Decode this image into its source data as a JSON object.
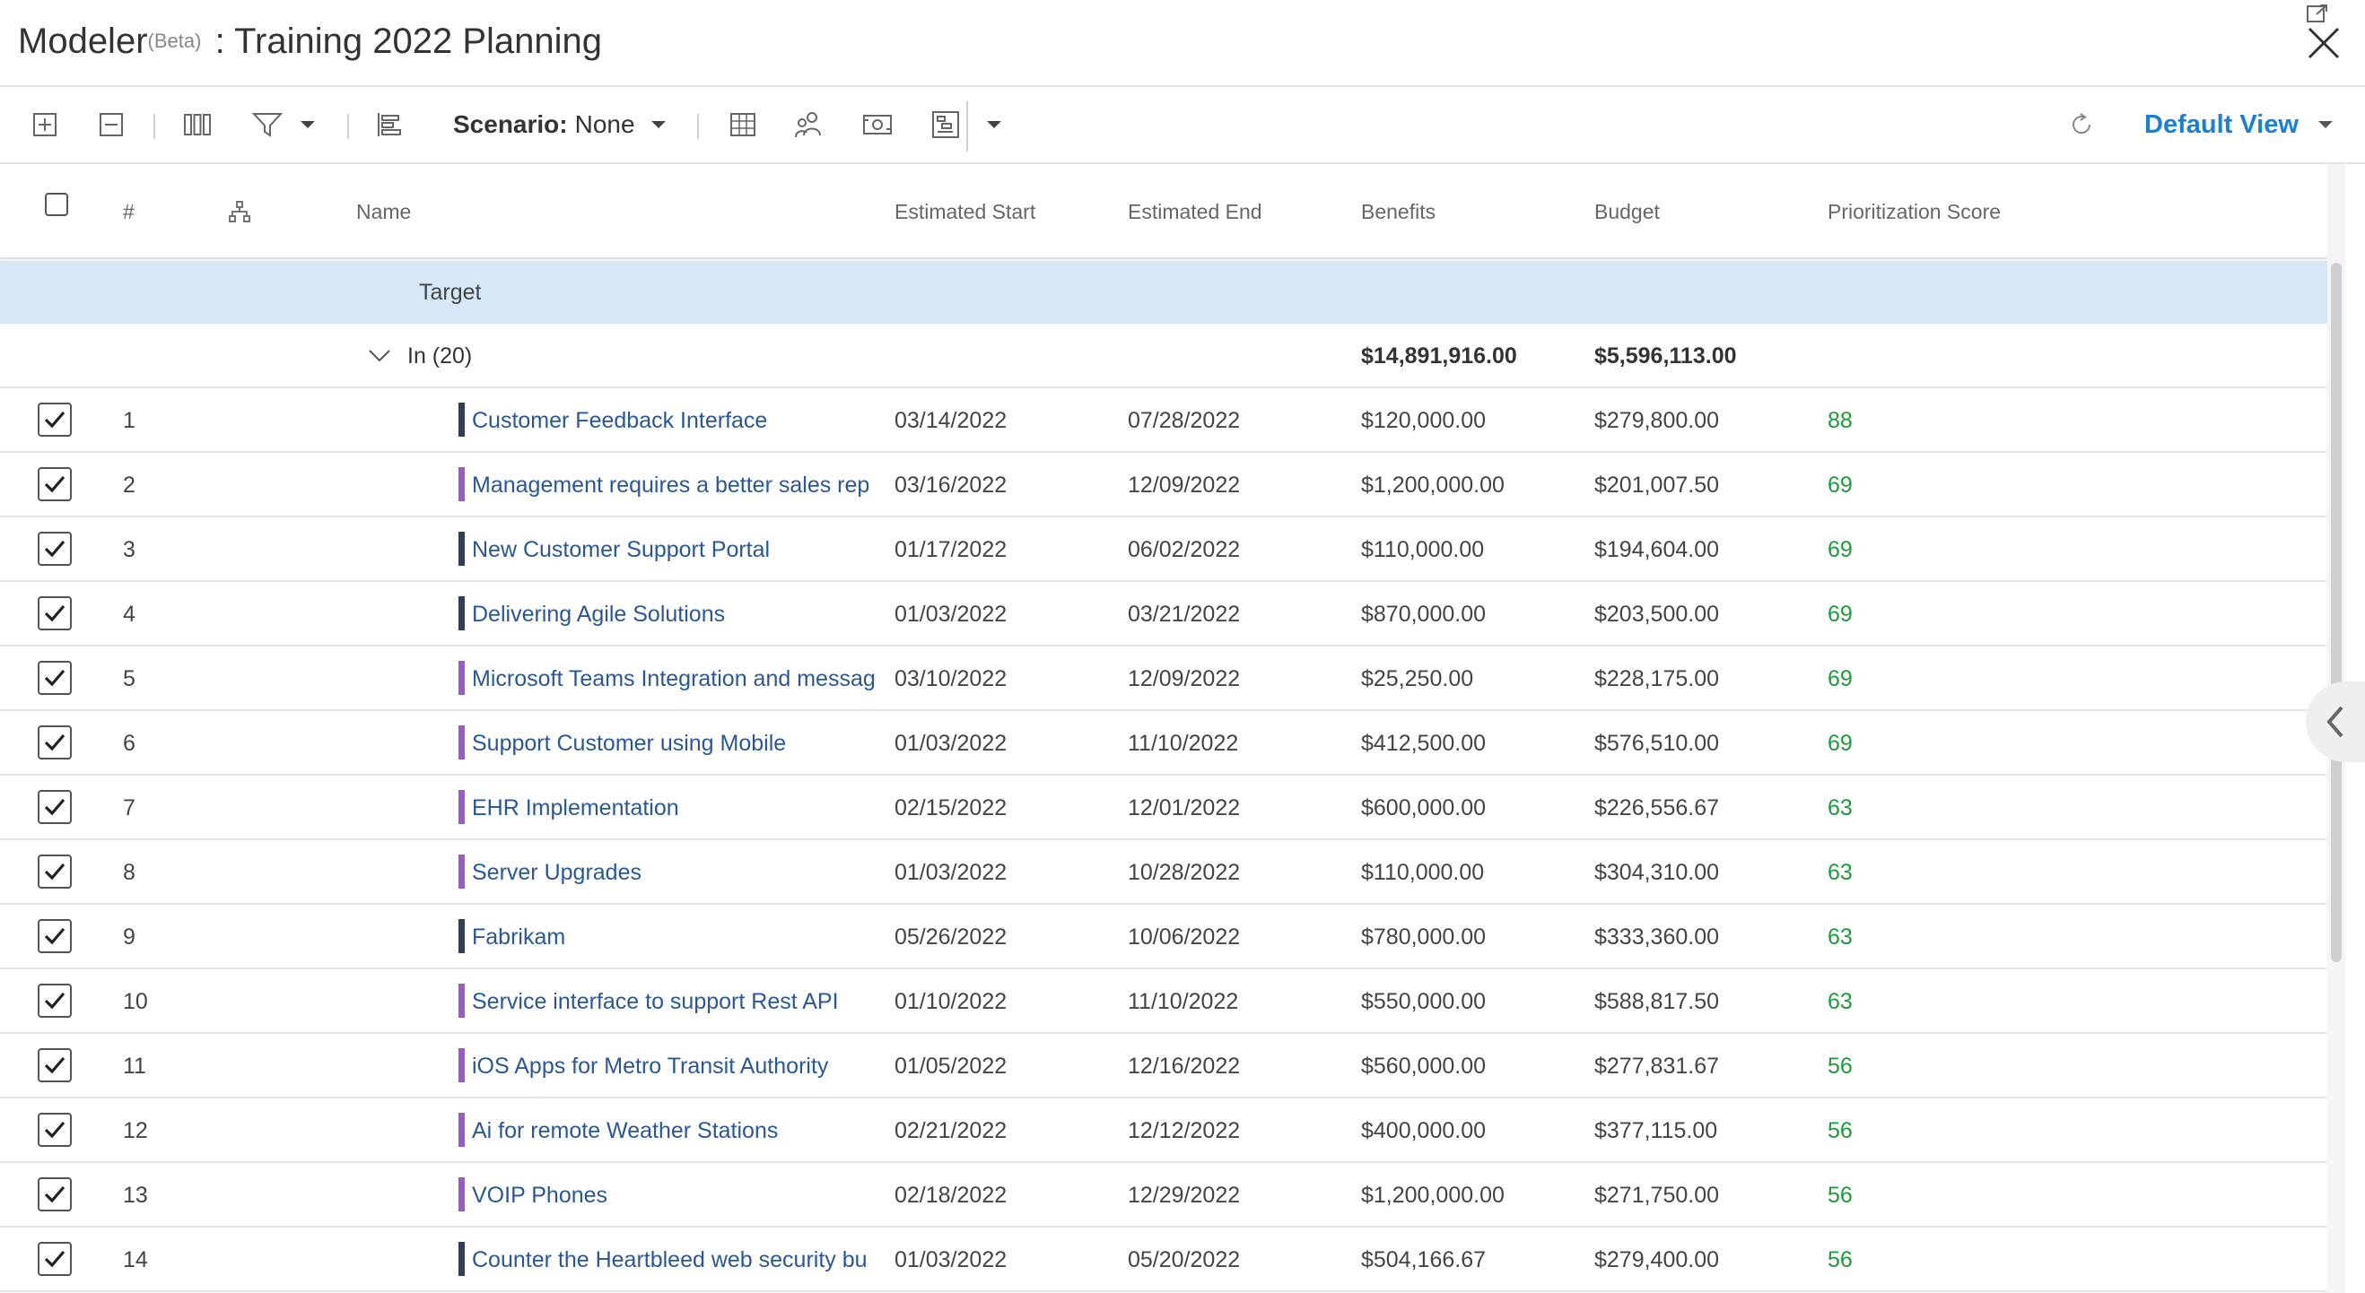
{
  "app": {
    "name": "Modeler",
    "beta": "(Beta)",
    "separator": ":",
    "title": "Training 2022 Planning"
  },
  "toolbar": {
    "scenario_label": "Scenario:",
    "scenario_value": "None",
    "view_label": "Default View"
  },
  "columns": {
    "num": "#",
    "name": "Name",
    "est_start": "Estimated Start",
    "est_end": "Estimated End",
    "benefits": "Benefits",
    "budget": "Budget",
    "score": "Prioritization Score"
  },
  "group": {
    "target_label": "Target",
    "in_label": "In (20)",
    "benefits_total": "$14,891,916.00",
    "budget_total": "$5,596,113.00"
  },
  "colors": {
    "accent": "#1a7fd6",
    "bar_dark": "#2f3f57",
    "bar_purple": "#9b59c6",
    "score_green": "#1f9a3a",
    "target_bg": "#d6e7f6"
  },
  "rows": [
    {
      "num": "1",
      "name": "Customer Feedback Interface",
      "bar": "dark",
      "start": "03/14/2022",
      "end": "07/28/2022",
      "benefits": "$120,000.00",
      "budget": "$279,800.00",
      "score": "88"
    },
    {
      "num": "2",
      "name": "Management requires a better sales rep",
      "bar": "purple",
      "start": "03/16/2022",
      "end": "12/09/2022",
      "benefits": "$1,200,000.00",
      "budget": "$201,007.50",
      "score": "69"
    },
    {
      "num": "3",
      "name": "New Customer Support Portal",
      "bar": "dark",
      "start": "01/17/2022",
      "end": "06/02/2022",
      "benefits": "$110,000.00",
      "budget": "$194,604.00",
      "score": "69"
    },
    {
      "num": "4",
      "name": "Delivering Agile Solutions",
      "bar": "dark",
      "start": "01/03/2022",
      "end": "03/21/2022",
      "benefits": "$870,000.00",
      "budget": "$203,500.00",
      "score": "69"
    },
    {
      "num": "5",
      "name": "Microsoft Teams Integration and messag",
      "bar": "purple",
      "start": "03/10/2022",
      "end": "12/09/2022",
      "benefits": "$25,250.00",
      "budget": "$228,175.00",
      "score": "69"
    },
    {
      "num": "6",
      "name": "Support Customer using Mobile",
      "bar": "purple",
      "start": "01/03/2022",
      "end": "11/10/2022",
      "benefits": "$412,500.00",
      "budget": "$576,510.00",
      "score": "69"
    },
    {
      "num": "7",
      "name": "EHR Implementation",
      "bar": "purple",
      "start": "02/15/2022",
      "end": "12/01/2022",
      "benefits": "$600,000.00",
      "budget": "$226,556.67",
      "score": "63"
    },
    {
      "num": "8",
      "name": "Server Upgrades",
      "bar": "purple",
      "start": "01/03/2022",
      "end": "10/28/2022",
      "benefits": "$110,000.00",
      "budget": "$304,310.00",
      "score": "63"
    },
    {
      "num": "9",
      "name": "Fabrikam",
      "bar": "dark",
      "start": "05/26/2022",
      "end": "10/06/2022",
      "benefits": "$780,000.00",
      "budget": "$333,360.00",
      "score": "63"
    },
    {
      "num": "10",
      "name": "Service interface to support Rest API",
      "bar": "purple",
      "start": "01/10/2022",
      "end": "11/10/2022",
      "benefits": "$550,000.00",
      "budget": "$588,817.50",
      "score": "63"
    },
    {
      "num": "11",
      "name": "iOS Apps for Metro Transit Authority",
      "bar": "purple",
      "start": "01/05/2022",
      "end": "12/16/2022",
      "benefits": "$560,000.00",
      "budget": "$277,831.67",
      "score": "56"
    },
    {
      "num": "12",
      "name": "Ai for remote Weather Stations",
      "bar": "purple",
      "start": "02/21/2022",
      "end": "12/12/2022",
      "benefits": "$400,000.00",
      "budget": "$377,115.00",
      "score": "56"
    },
    {
      "num": "13",
      "name": "VOIP Phones",
      "bar": "purple",
      "start": "02/18/2022",
      "end": "12/29/2022",
      "benefits": "$1,200,000.00",
      "budget": "$271,750.00",
      "score": "56"
    },
    {
      "num": "14",
      "name": "Counter the Heartbleed web security bu",
      "bar": "dark",
      "start": "01/03/2022",
      "end": "05/20/2022",
      "benefits": "$504,166.67",
      "budget": "$279,400.00",
      "score": "56"
    }
  ]
}
